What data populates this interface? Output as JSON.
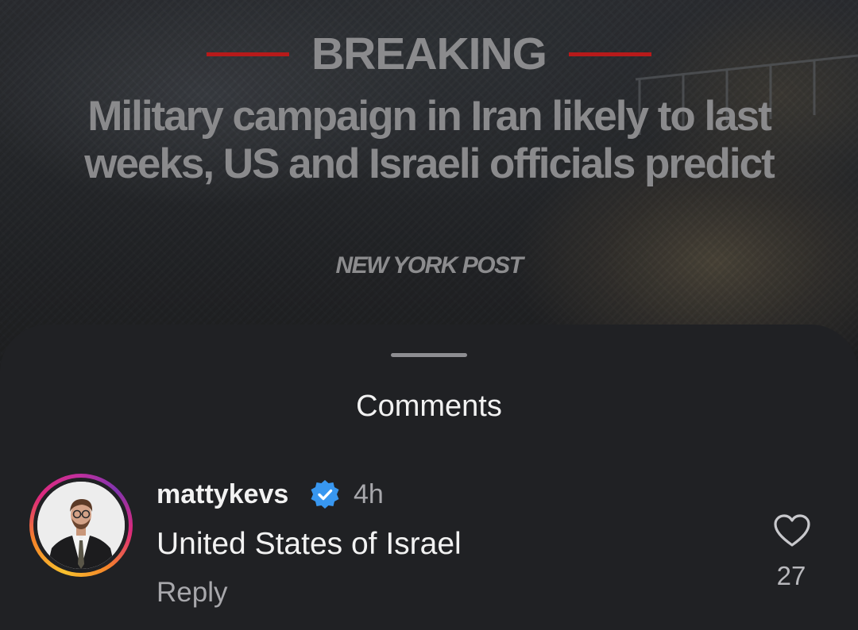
{
  "post": {
    "label": "BREAKING",
    "headline": "Military campaign in Iran likely to last weeks, US and Israeli officials predict",
    "source": "NEW YORK POST",
    "accent_color": "#b71a1a"
  },
  "comments_sheet": {
    "title": "Comments",
    "comments": [
      {
        "username": "mattykevs",
        "verified": true,
        "verified_icon": "verified-badge-icon",
        "time": "4h",
        "text": "United States of Israel",
        "reply_label": "Reply",
        "like_icon": "heart-outline-icon",
        "likes": "27"
      }
    ]
  },
  "colors": {
    "sheet_background": "#202124",
    "text_primary": "#f2f2f2",
    "text_secondary": "#a8a8ac",
    "verified_blue": "#3897f0"
  }
}
